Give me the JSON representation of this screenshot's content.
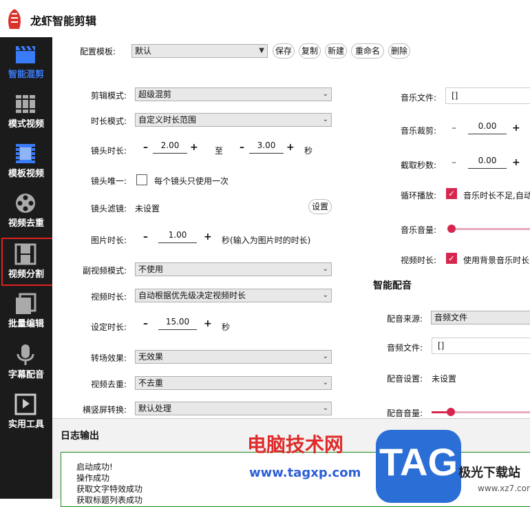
{
  "app": {
    "title": "龙虾智能剪辑"
  },
  "sidebar": {
    "items": [
      {
        "label": "智能混剪",
        "icon": "clapperboard-icon"
      },
      {
        "label": "模式视频",
        "icon": "books-icon"
      },
      {
        "label": "模板视频",
        "icon": "film-template-icon"
      },
      {
        "label": "视频去重",
        "icon": "film-reel-icon"
      },
      {
        "label": "视频分割",
        "icon": "film-strip-icon"
      },
      {
        "label": "批量编辑",
        "icon": "stacked-frames-icon"
      },
      {
        "label": "字幕配音",
        "icon": "microphone-icon"
      },
      {
        "label": "实用工具",
        "icon": "play-logo-icon"
      }
    ],
    "active_index": 0
  },
  "template": {
    "label": "配置模板:",
    "value": "默认",
    "buttons": {
      "save": "保存",
      "copy": "复制",
      "new": "新建",
      "rename": "重命名",
      "delete": "删除"
    }
  },
  "left": {
    "edit_mode": {
      "label": "剪辑模式:",
      "value": "超级混剪"
    },
    "duration_mode": {
      "label": "时长模式:",
      "value": "自定义时长范围"
    },
    "shot_duration": {
      "label": "镜头时长:",
      "min": "2.00",
      "to": "至",
      "max": "3.00",
      "unit": "秒"
    },
    "shot_unique": {
      "label": "镜头唯一:",
      "text": "每个镜头只使用一次",
      "checked": false
    },
    "shot_filter": {
      "label": "镜头滤镜:",
      "value": "未设置",
      "button": "设置"
    },
    "image_duration": {
      "label": "图片时长:",
      "value": "1.00",
      "unit": "秒(输入为图片时的时长)"
    },
    "sub_video_mode": {
      "label": "副视频模式:",
      "value": "不使用"
    },
    "video_duration": {
      "label": "视频时长:",
      "value": "自动根据优先级决定视频时长"
    },
    "set_duration": {
      "label": "设定时长:",
      "value": "15.00",
      "unit": "秒"
    },
    "transition": {
      "label": "转场效果:",
      "value": "无效果"
    },
    "dedup": {
      "label": "视频去重:",
      "value": "不去重"
    },
    "orientation": {
      "label": "横竖屏转换:",
      "value": "默认处理"
    }
  },
  "right": {
    "music_file": {
      "label": "音乐文件:",
      "value": "[]"
    },
    "music_trim": {
      "label": "音乐裁剪:",
      "value": "0.00"
    },
    "trim_seconds": {
      "label": "截取秒数:",
      "value": "0.00"
    },
    "loop": {
      "label": "循环播放:",
      "text": "音乐时长不足,自动",
      "checked": true
    },
    "music_volume": {
      "label": "音乐音量:",
      "level": 0.02
    },
    "video_duration": {
      "label": "视频时长:",
      "text": "使用背景音乐时长",
      "checked": true
    },
    "dubbing": {
      "title": "智能配音",
      "source": {
        "label": "配音来源:",
        "value": "音频文件"
      },
      "audio_file": {
        "label": "音频文件:",
        "value": "[]"
      },
      "settings": {
        "label": "配音设置:",
        "value": "未设置"
      },
      "volume": {
        "label": "配音音量:",
        "level": 0.2
      }
    }
  },
  "log": {
    "title": "日志输出",
    "lines": [
      "启动成功!",
      "操作成功",
      "获取文字特效成功",
      "获取标题列表成功"
    ]
  },
  "watermark": {
    "cn": "电脑技术网",
    "url": "www.tagxp.com",
    "tag": "TAG",
    "site": "极光下载站",
    "site_url": "www.xz7.com"
  },
  "colors": {
    "accent": "#d7264e",
    "sidebar_bg": "#1b1b1b",
    "highlight": "#e02020",
    "active_label": "#3a7bf7"
  }
}
